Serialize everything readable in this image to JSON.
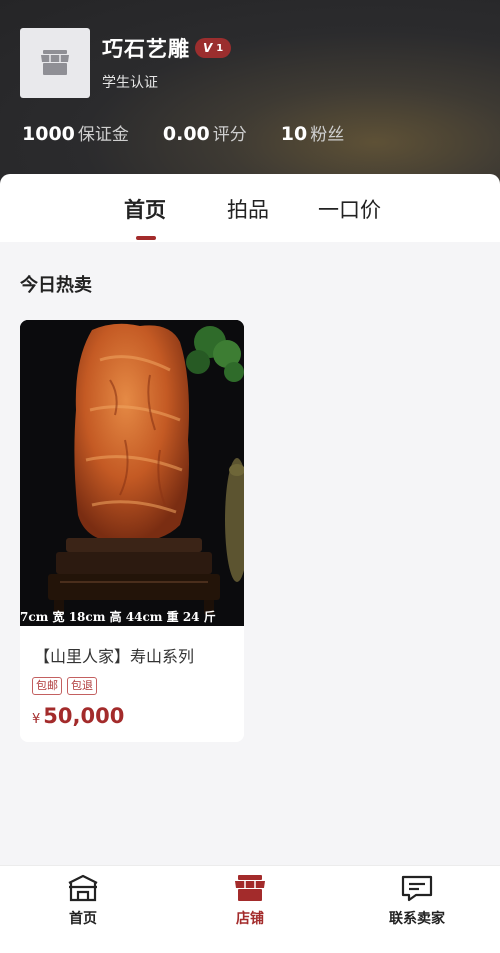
{
  "shop": {
    "name": "巧石艺雕",
    "level": "1",
    "level_prefix": "V",
    "certification": "学生认证",
    "avatar_icon": "store-icon"
  },
  "stats": [
    {
      "value": "1000",
      "label": "保证金"
    },
    {
      "value": "0.00",
      "label": "评分"
    },
    {
      "value": "10",
      "label": "粉丝"
    }
  ],
  "tabs": [
    {
      "label": "首页",
      "active": true
    },
    {
      "label": "拍品",
      "active": false
    },
    {
      "label": "一口价",
      "active": false
    }
  ],
  "section": {
    "title": "今日热卖"
  },
  "products": [
    {
      "image_caption": "7cm 宽 18cm 高 44cm 重 24 斤",
      "title": "【山里人家】寿山系列",
      "tags": [
        "包邮",
        "包退"
      ],
      "currency": "¥",
      "price": "50,000"
    }
  ],
  "bottom_nav": [
    {
      "label": "首页",
      "icon": "home-icon",
      "active": false
    },
    {
      "label": "店铺",
      "icon": "store-icon",
      "active": true
    },
    {
      "label": "联系卖家",
      "icon": "message-icon",
      "active": false
    }
  ],
  "colors": {
    "accent": "#a32b2b",
    "header_bg": "#2b2b2d",
    "page_bg": "#f5f5f7"
  }
}
